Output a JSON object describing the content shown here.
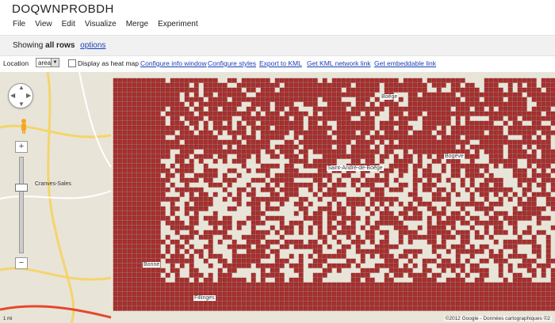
{
  "header": {
    "title": "DOQWNPROBDH"
  },
  "menu": [
    "File",
    "View",
    "Edit",
    "Visualize",
    "Merge",
    "Experiment"
  ],
  "rowbar": {
    "showing_prefix": "Showing",
    "showing_bold": "all rows",
    "options_link": "options"
  },
  "toolbar": {
    "location_label": "Location",
    "location_value": "area",
    "heatmap_label": "Display as heat map",
    "links": [
      "Configure info window",
      "Configure styles",
      "Export to KML",
      "Get KML network link",
      "Get embeddable link"
    ]
  },
  "map": {
    "copyright": "©2012 Google - Données cartographiques ©2",
    "scale": "1 mi",
    "place_labels": [
      "Bogève",
      "Saint-André-de-Boëge",
      "Cranves-Sales",
      "Bonne",
      "Fillinges",
      "Boëge"
    ],
    "colors": {
      "cell_fill": "#a8302f",
      "cell_stroke": "#7a1a1a",
      "map_bg": "#e8e4d8"
    }
  }
}
